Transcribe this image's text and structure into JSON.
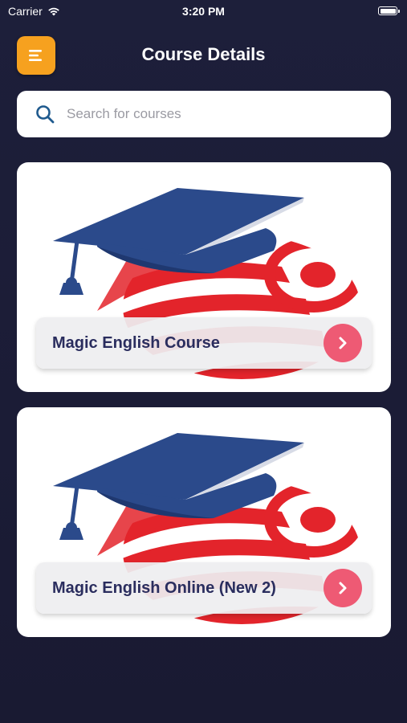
{
  "status_bar": {
    "carrier": "Carrier",
    "time": "3:20 PM"
  },
  "header": {
    "title": "Course Details",
    "menu_icon": "menu-icon",
    "menu_color": "#f6a11f"
  },
  "search": {
    "placeholder": "Search for courses",
    "value": "",
    "icon": "search-icon"
  },
  "courses": [
    {
      "title": "Magic English Course"
    },
    {
      "title": "Magic English Online (New 2)"
    }
  ],
  "colors": {
    "background": "#1d1f3a",
    "accent": "#ee5a74",
    "text_dark": "#2a2d5e"
  }
}
